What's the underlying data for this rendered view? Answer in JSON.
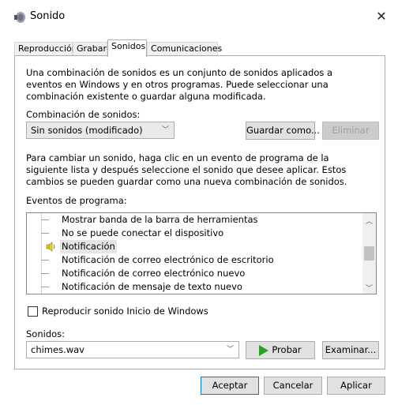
{
  "window": {
    "title": "Sonido",
    "close_glyph": "✕",
    "icon": "speaker-app-icon"
  },
  "tabs": [
    {
      "label": "Reproducción"
    },
    {
      "label": "Grabar"
    },
    {
      "label": "Sonidos",
      "active": true
    },
    {
      "label": "Comunicaciones"
    }
  ],
  "panel": {
    "intro": "Una combinación de sonidos es un conjunto de sonidos aplicados a eventos en Windows y en otros programas. Puede seleccionar una combinación existente o guardar alguna modificada.",
    "scheme_label": "Combinación de sonidos:",
    "scheme_value": "Sin sonidos (modificado)",
    "save_as": "Guardar como...",
    "delete": "Eliminar",
    "change_help": "Para cambiar un sonido, haga clic en un evento de programa de la siguiente lista y después seleccione el sonido que desee aplicar. Estos cambios se pueden guardar como una nueva combinación de sonidos.",
    "events_label": "Eventos de programa:",
    "events": [
      {
        "label": "Mostrar banda de la barra de herramientas"
      },
      {
        "label": "No se puede conectar el dispositivo"
      },
      {
        "label": "Notificación",
        "selected": true,
        "icon": "speaker-icon"
      },
      {
        "label": "Notificación de correo electrónico de escritorio"
      },
      {
        "label": "Notificación de correo electrónico nuevo"
      },
      {
        "label": "Notificación de mensaje de texto nuevo"
      }
    ],
    "startup_checkbox": "Reproducir sonido Inicio de Windows",
    "startup_checked": false,
    "sounds_label": "Sonidos:",
    "sound_value": "chimes.wav",
    "test": "Probar",
    "browse": "Examinar..."
  },
  "footer": {
    "ok": "Aceptar",
    "cancel": "Cancelar",
    "apply": "Aplicar"
  },
  "colors": {
    "accent": "#0078d7",
    "play": "#2aa12a",
    "speaker": "#e8d21b"
  }
}
